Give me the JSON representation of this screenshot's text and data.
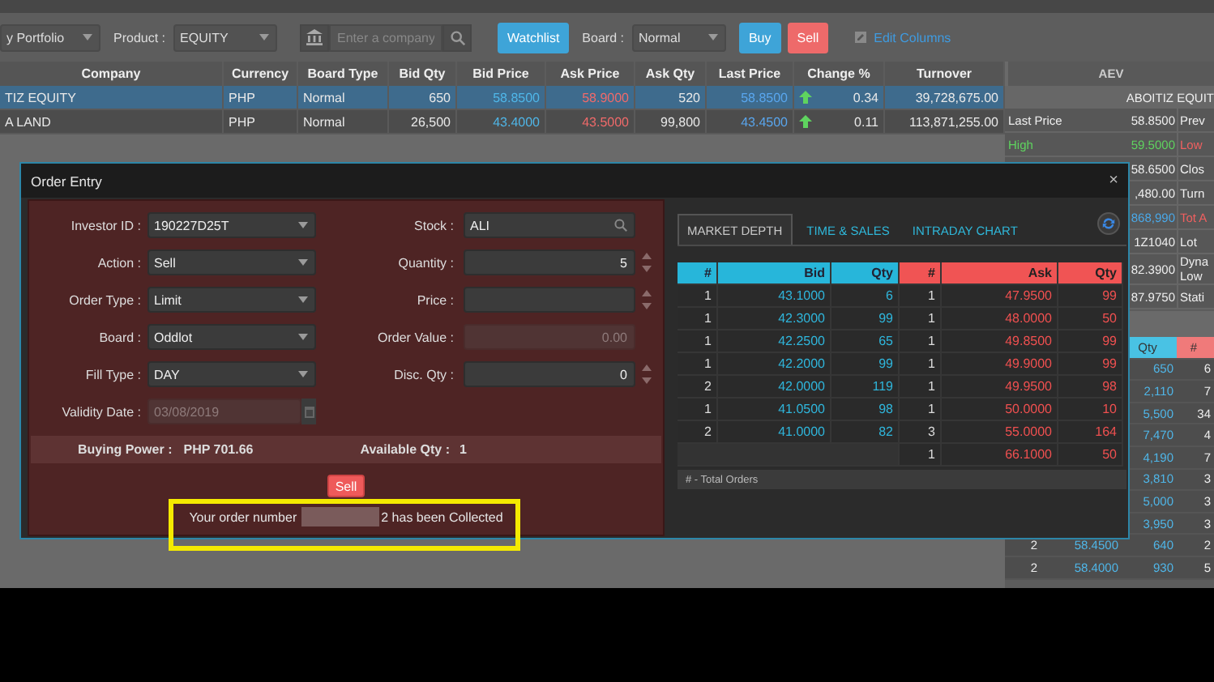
{
  "toolbar": {
    "portfolio": "y Portfolio",
    "product_label": "Product :",
    "product": "EQUITY",
    "company_placeholder": "Enter a company",
    "watchlist_button": "Watchlist",
    "board_label": "Board :",
    "board": "Normal",
    "buy_button": "Buy",
    "sell_button": "Sell",
    "edit_columns": "Edit Columns"
  },
  "watchlist": {
    "columns": [
      "Company",
      "Currency",
      "Board Type",
      "Bid Qty",
      "Bid Price",
      "Ask Price",
      "Ask Qty",
      "Last Price",
      "Change %",
      "Turnover"
    ],
    "rows": [
      {
        "selected": true,
        "cells": [
          "TIZ EQUITY",
          "PHP",
          "Normal",
          "650",
          "58.8500",
          "58.9000",
          "520",
          "58.8500",
          "0.34",
          "39,728,675.00"
        ]
      },
      {
        "selected": false,
        "cells": [
          "A LAND",
          "PHP",
          "Normal",
          "26,500",
          "43.4000",
          "43.5000",
          "99,800",
          "43.4500",
          "0.11",
          "113,871,255.00"
        ]
      }
    ]
  },
  "quote_panel": {
    "symbol": "AEV",
    "name": "ABOITIZ EQUIT",
    "rows": [
      {
        "label": {
          "text": "Last Price"
        },
        "value": {
          "text": "58.8500"
        },
        "label2": {
          "text": "Prev"
        }
      },
      {
        "label": {
          "text": "High",
          "color": "#5fd35f"
        },
        "value": {
          "text": "59.5000",
          "color": "#5fd35f"
        },
        "label2": {
          "text": "Low",
          "color": "#f06060"
        }
      },
      {
        "value": {
          "text": "58.6500"
        },
        "label2": {
          "text": "Clos"
        }
      },
      {
        "value": {
          "text": ",480.00"
        },
        "label2": {
          "text": "Turn"
        }
      },
      {
        "value": {
          "text": "868,990",
          "color": "#4aa8e8"
        },
        "label2": {
          "text": "Tot A",
          "color": "#f06060"
        }
      },
      {
        "value": {
          "text": "1Z1040"
        },
        "label2": {
          "text": "Lot"
        }
      },
      {
        "value": {
          "text": "82.3900"
        },
        "label2": {
          "text": "Dyna Low"
        }
      },
      {
        "value": {
          "text": "87.9750"
        },
        "label2": {
          "text": "Stati"
        }
      }
    ],
    "depth_columns": [
      "Qty",
      "#"
    ],
    "depth_rows": [
      {
        "qty": "650",
        "count": "6"
      },
      {
        "qty": "2,110",
        "count": "7"
      },
      {
        "qty": "5,500",
        "count": "34"
      },
      {
        "qty": "7,470",
        "count": "4"
      },
      {
        "qty": "4,190",
        "count": "7"
      },
      {
        "qty": "3,810",
        "count": "3"
      },
      {
        "qty": "5,000",
        "count": "3"
      },
      {
        "qty": "3,950",
        "count": "3"
      },
      {
        "orders": "2",
        "price": "58.4500",
        "qty": "640",
        "count": "2"
      },
      {
        "orders": "2",
        "price": "58.4000",
        "qty": "930",
        "count": "5"
      }
    ]
  },
  "order_entry": {
    "title": "Order Entry",
    "close": "×",
    "left_fields": [
      {
        "label": "Investor ID :",
        "value": "190227D25T",
        "kind": "select",
        "disabled": false
      },
      {
        "label": "Action :",
        "value": "Sell",
        "kind": "select",
        "disabled": false
      },
      {
        "label": "Order Type :",
        "value": "Limit",
        "kind": "select",
        "disabled": false
      },
      {
        "label": "Board :",
        "value": "Oddlot",
        "kind": "select",
        "disabled": false
      },
      {
        "label": "Fill Type :",
        "value": "DAY",
        "kind": "select",
        "disabled": false
      },
      {
        "label": "Validity Date :",
        "value": "03/08/2019",
        "kind": "date",
        "disabled": true
      }
    ],
    "right_fields": [
      {
        "label": "Stock :",
        "value": "ALI",
        "kind": "search",
        "disabled": false
      },
      {
        "label": "Quantity :",
        "value": "5",
        "kind": "number",
        "disabled": false
      },
      {
        "label": "Price :",
        "kind": "number",
        "disabled": false
      },
      {
        "label": "Order Value :",
        "value": "0.00",
        "kind": "text",
        "disabled": true
      },
      {
        "label": "Disc. Qty :",
        "value": "0",
        "kind": "number",
        "disabled": false
      }
    ],
    "buying_power_label": "Buying Power :",
    "buying_power": "PHP 701.66",
    "available_label": "Available Qty :",
    "available": "1",
    "submit_button": "Sell",
    "message_start": "Your order number",
    "message_end": "2 has been Collected",
    "depth": {
      "tabs": [
        {
          "label": "MARKET DEPTH",
          "selected": true
        },
        {
          "label": "TIME & SALES",
          "selected": false
        },
        {
          "label": "INTRADAY CHART",
          "selected": false
        }
      ],
      "columns": [
        "#",
        "Bid",
        "Qty",
        "#",
        "Ask",
        "Qty"
      ],
      "rows": [
        {
          "bid_orders": "1",
          "bid": "43.1000",
          "bid_qty": "6",
          "ask_orders": "1",
          "ask": "47.9500",
          "ask_qty": "99"
        },
        {
          "bid_orders": "1",
          "bid": "42.3000",
          "bid_qty": "99",
          "ask_orders": "1",
          "ask": "48.0000",
          "ask_qty": "50"
        },
        {
          "bid_orders": "1",
          "bid": "42.2500",
          "bid_qty": "65",
          "ask_orders": "1",
          "ask": "49.8500",
          "ask_qty": "99"
        },
        {
          "bid_orders": "1",
          "bid": "42.2000",
          "bid_qty": "99",
          "ask_orders": "1",
          "ask": "49.9000",
          "ask_qty": "99"
        },
        {
          "bid_orders": "2",
          "bid": "42.0000",
          "bid_qty": "119",
          "ask_orders": "1",
          "ask": "49.9500",
          "ask_qty": "98"
        },
        {
          "bid_orders": "1",
          "bid": "41.0500",
          "bid_qty": "98",
          "ask_orders": "1",
          "ask": "50.0000",
          "ask_qty": "10"
        },
        {
          "bid_orders": "2",
          "bid": "41.0000",
          "bid_qty": "82",
          "ask_orders": "3",
          "ask": "55.0000",
          "ask_qty": "164"
        },
        {
          "ask_orders": "1",
          "ask": "66.1000",
          "ask_qty": "50"
        }
      ],
      "footer": "# - Total Orders"
    }
  }
}
